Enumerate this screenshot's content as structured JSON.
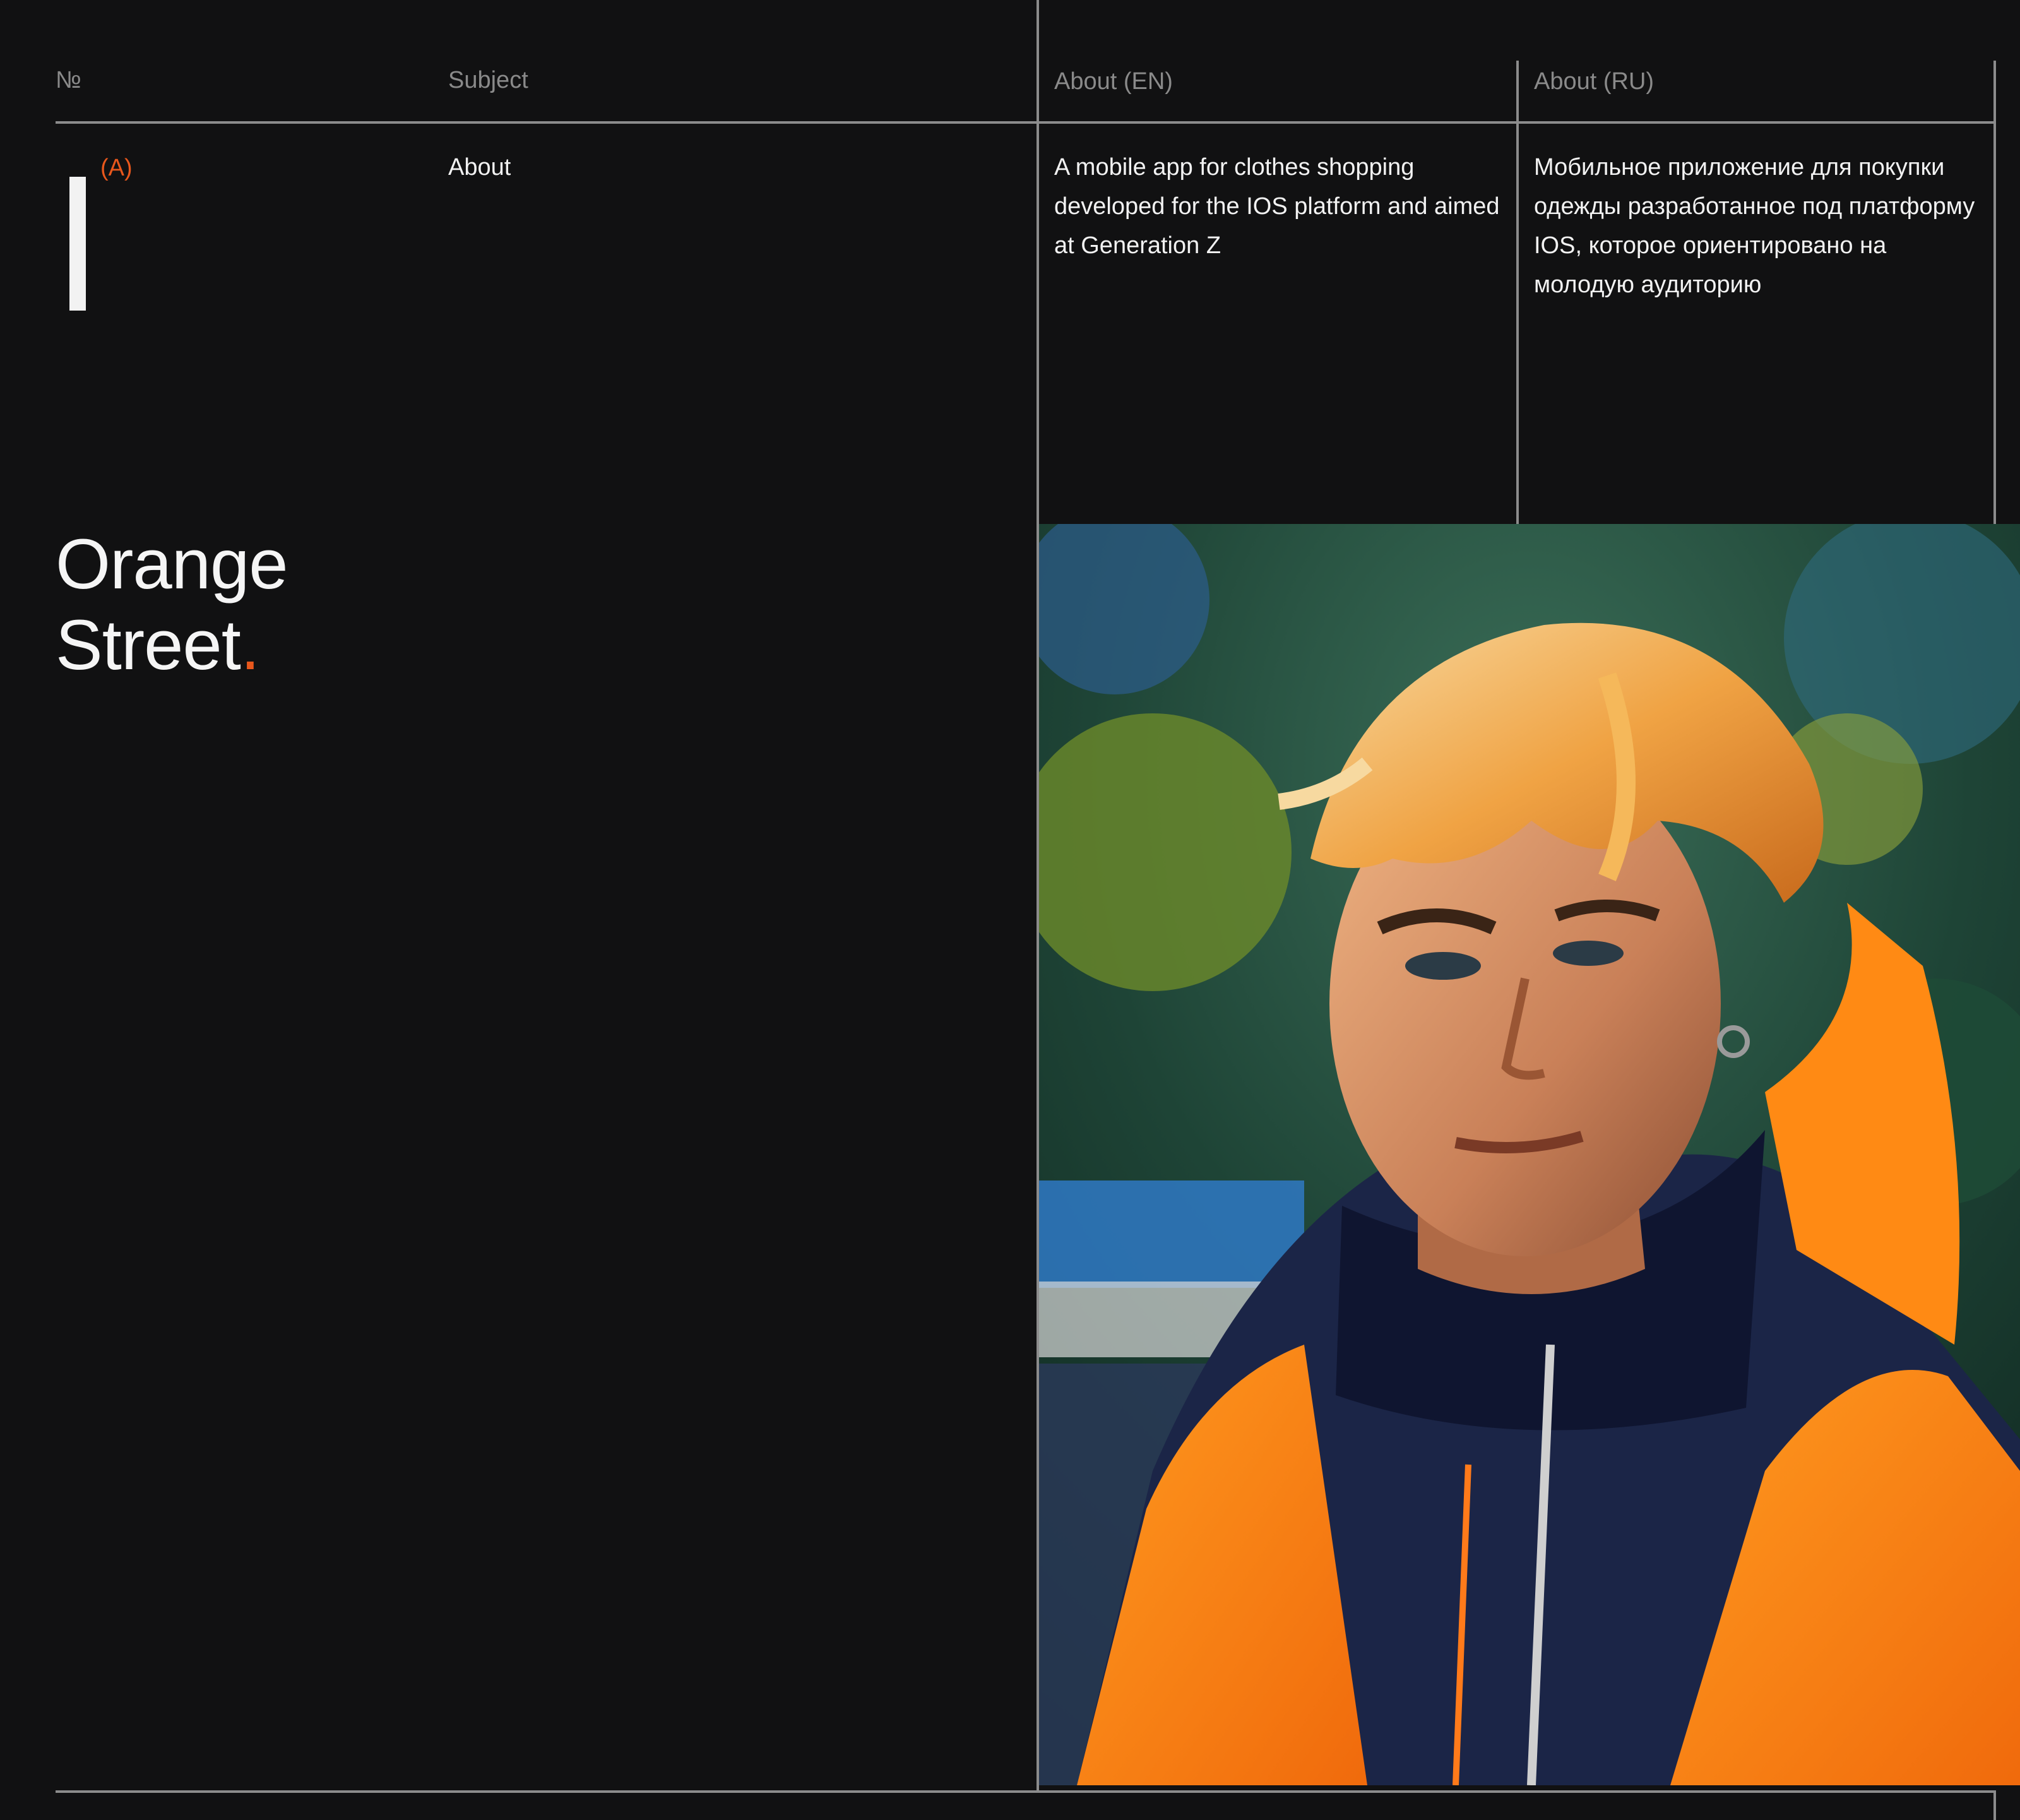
{
  "table": {
    "headers": {
      "number": "№",
      "subject": "Subject",
      "about_en": "About (EN)",
      "about_ru": "About (RU)"
    },
    "row": {
      "index_letter": "(A)",
      "subject": "About",
      "about_en": "A mobile app for clothes shopping developed for the IOS platform and aimed at Generation Z",
      "about_ru": "Мобильное приложение для покупки одежды разработанное под платформу IOS, которое ориентировано на молодую аудиторию"
    }
  },
  "brand": {
    "line1": "Orange",
    "line2": "Street",
    "dot": "."
  },
  "colors": {
    "background": "#111112",
    "text": "#f2f2f2",
    "muted": "#8a8a8a",
    "accent": "#e8571c",
    "rule": "#8c8c8c"
  },
  "photo": {
    "icon": "portrait-photo"
  }
}
